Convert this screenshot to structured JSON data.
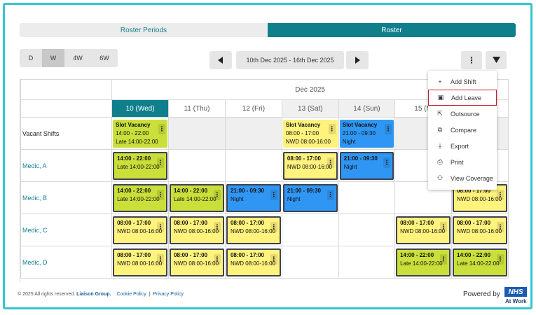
{
  "tabs": [
    {
      "label": "Roster Periods",
      "active": false
    },
    {
      "label": "Roster",
      "active": true
    }
  ],
  "view_options": [
    {
      "label": "D",
      "selected": false
    },
    {
      "label": "W",
      "selected": true
    },
    {
      "label": "4W",
      "selected": false
    },
    {
      "label": "6W",
      "selected": false
    }
  ],
  "date_range": "10th Dec 2025 - 16th Dec 2025",
  "month_header": "Dec 2025",
  "days": [
    {
      "label": "10 (Wed)",
      "today": true,
      "weekend": false
    },
    {
      "label": "11 (Thu)",
      "today": false,
      "weekend": false
    },
    {
      "label": "12 (Fri)",
      "today": false,
      "weekend": false
    },
    {
      "label": "13 (Sat)",
      "today": false,
      "weekend": true
    },
    {
      "label": "14 (Sun)",
      "today": false,
      "weekend": true
    },
    {
      "label": "15 (M",
      "today": false,
      "weekend": false
    },
    {
      "label": "",
      "today": false,
      "weekend": false
    }
  ],
  "rows": [
    {
      "name": "Vacant Shifts",
      "dark": true,
      "cells": [
        {
          "color": "green",
          "outlined": false,
          "lines": [
            "Slot Vacancy",
            "14:00 - 22:00",
            "Late 14:00-22:00"
          ]
        },
        {
          "blank": true
        },
        {
          "blank": true
        },
        {
          "color": "yellow",
          "outlined": false,
          "lines": [
            "Slot Vacancy",
            "08:00 - 17:00",
            "NWD 08:00-16:00"
          ]
        },
        {
          "color": "blue",
          "outlined": false,
          "lines": [
            "Slot Vacancy",
            "21:00 - 09:30",
            "Night"
          ]
        },
        {
          "blank": true
        },
        {
          "blank": true
        }
      ]
    },
    {
      "name": "Medic, A",
      "dark": false,
      "cells": [
        {
          "color": "green",
          "outlined": true,
          "lines": [
            "14:00 - 22:00",
            "Late 14:00-22:00"
          ]
        },
        {
          "empty": true
        },
        {
          "empty": true
        },
        {
          "color": "yellow",
          "outlined": true,
          "lines": [
            "08:00 - 17:00",
            "NWD 08:00-16:00"
          ]
        },
        {
          "color": "blue",
          "outlined": true,
          "lines": [
            "21:00 - 09:30",
            "Night"
          ]
        },
        {
          "empty": true
        },
        {
          "empty": true
        }
      ]
    },
    {
      "name": "Medic, B",
      "dark": false,
      "cells": [
        {
          "color": "green",
          "outlined": true,
          "lines": [
            "14:00 - 22:00",
            "Late 14:00-22:00"
          ]
        },
        {
          "color": "green",
          "outlined": true,
          "lines": [
            "14:00 - 22:00",
            "Late 14:00-22:00"
          ]
        },
        {
          "color": "blue",
          "outlined": true,
          "lines": [
            "21:00 - 09:30",
            "Night"
          ]
        },
        {
          "color": "blue",
          "outlined": true,
          "lines": [
            "21:00 - 09:30",
            "Night"
          ]
        },
        {
          "empty": true
        },
        {
          "empty": true
        },
        {
          "color": "yellow",
          "outlined": true,
          "lines": [
            "08:00 - 17:00",
            "NWD 08:00-16:00"
          ]
        }
      ]
    },
    {
      "name": "Medic, C",
      "dark": false,
      "cells": [
        {
          "color": "yellow",
          "outlined": true,
          "lines": [
            "08:00 - 17:00",
            "NWD 08:00-16:00"
          ]
        },
        {
          "color": "yellow",
          "outlined": true,
          "lines": [
            "08:00 - 17:00",
            "NWD 08:00-16:00"
          ]
        },
        {
          "color": "yellow",
          "outlined": true,
          "lines": [
            "08:00 - 17:00",
            "NWD 08:00-16:00"
          ]
        },
        {
          "empty": true
        },
        {
          "empty": true
        },
        {
          "color": "yellow",
          "outlined": true,
          "lines": [
            "08:00 - 17:00",
            "NWD 08:00-16:00"
          ]
        },
        {
          "color": "yellow",
          "outlined": true,
          "lines": [
            "08:00 - 17:00",
            "NWD 08:00-16:00"
          ]
        }
      ]
    },
    {
      "name": "Medic, D",
      "dark": false,
      "cells": [
        {
          "color": "yellow",
          "outlined": true,
          "lines": [
            "08:00 - 17:00",
            "NWD 08:00-16:00"
          ]
        },
        {
          "color": "yellow",
          "outlined": true,
          "lines": [
            "08:00 - 17:00",
            "NWD 08:00-16:00"
          ]
        },
        {
          "color": "yellow",
          "outlined": true,
          "lines": [
            "08:00 - 17:00",
            "NWD 08:00-16:00"
          ]
        },
        {
          "empty": true
        },
        {
          "empty": true
        },
        {
          "color": "green",
          "outlined": true,
          "lines": [
            "14:00 - 22:00",
            "Late 14:00-22:00"
          ]
        },
        {
          "color": "green",
          "outlined": true,
          "lines": [
            "14:00 - 22:00",
            "Late 14:00-22:00"
          ]
        }
      ]
    }
  ],
  "dropdown": [
    {
      "label": "Add Shift",
      "icon": "plus-icon",
      "glyph": "+",
      "highlighted": false
    },
    {
      "label": "Add Leave",
      "icon": "calendar-leave-icon",
      "glyph": "▣",
      "highlighted": true
    },
    {
      "label": "Outsource",
      "icon": "outsource-icon",
      "glyph": "⇱",
      "highlighted": false
    },
    {
      "label": "Compare",
      "icon": "compare-icon",
      "glyph": "⧉",
      "highlighted": false
    },
    {
      "label": "Export",
      "icon": "export-icon",
      "glyph": "⤓",
      "highlighted": false
    },
    {
      "label": "Print",
      "icon": "print-icon",
      "glyph": "⎙",
      "highlighted": false
    },
    {
      "label": "View Coverage",
      "icon": "coverage-icon",
      "glyph": "⚇",
      "highlighted": false
    }
  ],
  "footer": {
    "copyright": "© 2025 All rights reserved.",
    "brand": "Liaison Group.",
    "cookie_policy": "Cookie Policy",
    "separator": "|",
    "privacy_policy": "Privacy Policy",
    "powered_by": "Powered by",
    "nhs": "NHS",
    "at_work": "At Work"
  },
  "colors": {
    "accent": "#0f7f8c",
    "frame": "#37c6cf",
    "yellow": "#fff27d",
    "green": "#cadf3a",
    "blue": "#2f97f3",
    "highlight": "#c01f2f"
  }
}
